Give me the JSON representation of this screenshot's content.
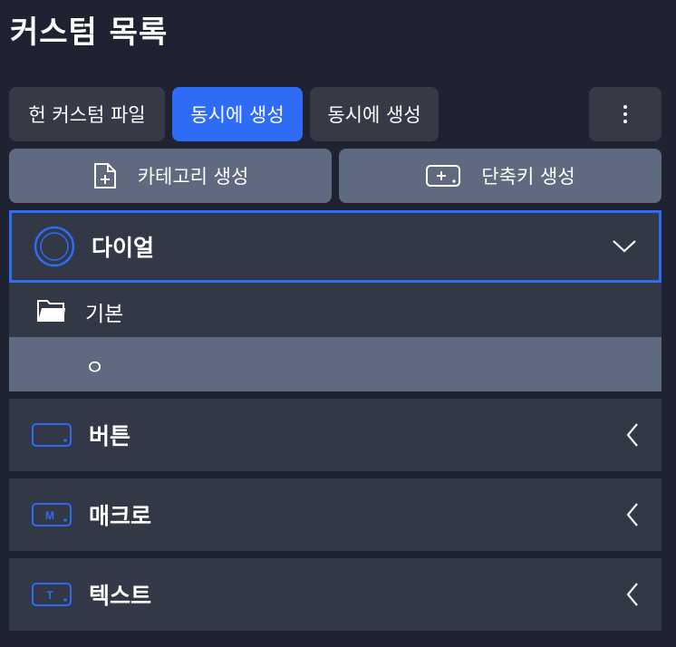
{
  "header": {
    "title": "커스텀 목록"
  },
  "toolbar": {
    "new_custom_file": "헌 커스텀 파일",
    "create_simultaneous_active": "동시에 생성",
    "create_simultaneous": "동시에 생성",
    "more_icon": "more-vertical-icon"
  },
  "actions": {
    "create_category": "카테고리 생성",
    "create_shortcut": "단축키 생성",
    "category_icon": "file-plus-icon",
    "shortcut_icon": "keyboard-plus-icon"
  },
  "list": {
    "dial": {
      "label": "다이얼",
      "icon": "dial-icon",
      "expanded": true,
      "folder_label": "기본",
      "folder_icon": "folder-open-icon",
      "item_label": "ㅇ"
    },
    "button": {
      "label": "버튼",
      "icon": "button-icon",
      "badge": ""
    },
    "macro": {
      "label": "매크로",
      "icon": "macro-icon",
      "badge": "M"
    },
    "text": {
      "label": "텍스트",
      "icon": "text-icon",
      "badge": "T"
    }
  },
  "colors": {
    "background": "#1f2230",
    "accent": "#2f6cf6",
    "panel": "#333846",
    "button_dark": "#363a47",
    "button_slate": "#5f6a80"
  }
}
